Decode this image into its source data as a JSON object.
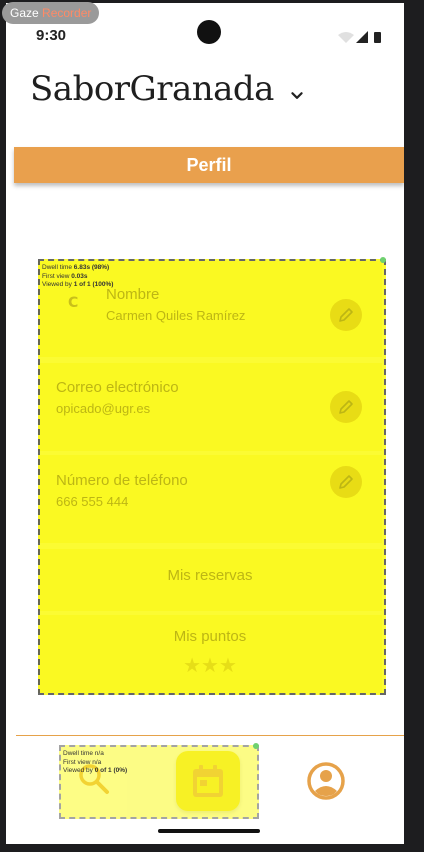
{
  "overlay": {
    "tool_prefix": "Gaze",
    "tool_suffix": " Recorder"
  },
  "status_bar": {
    "time": "9:30"
  },
  "header": {
    "title": "SaborGranada"
  },
  "tab": {
    "label": "Perfil"
  },
  "profile": {
    "avatar_letter": "C",
    "name_label": "Nombre",
    "name_value": "Carmen Quiles Ramírez",
    "email_label": "Correo electrónico",
    "email_value": "opicado@ugr.es",
    "phone_label": "Número de teléfono",
    "phone_value": "666 555 444",
    "reservations_label": "Mis reservas",
    "points_label": "Mis puntos",
    "points_stars": "★★★"
  },
  "heatmap_main": {
    "line1_prefix": "Dwell time ",
    "line1_value": "6.83s (98%)",
    "line2_prefix": "First view ",
    "line2_value": "0.03s",
    "line3_prefix": "Viewed by ",
    "line3_value": "1 of 1 (100%)"
  },
  "heatmap_nav": {
    "line1": "Dwell time n/a",
    "line2": "First view n/a",
    "line3_prefix": "Viewed by ",
    "line3_value": "0 of 1 (0%)"
  },
  "colors": {
    "accent": "#e9a04d",
    "heatmap": "#fbfb22",
    "nav_active": "#f3e62a"
  },
  "icons": {
    "title": "chevron-down-icon",
    "edit": "pencil-icon",
    "nav_left": "search-icon",
    "nav_center": "calendar-icon",
    "nav_right": "account-circle-icon"
  }
}
